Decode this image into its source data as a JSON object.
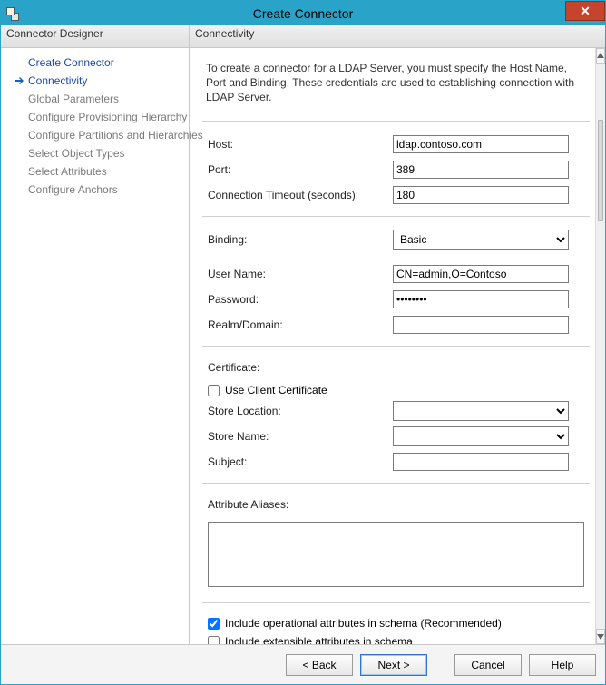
{
  "window": {
    "title": "Create Connector"
  },
  "sidebar": {
    "header": "Connector Designer",
    "items": [
      {
        "label": "Create Connector",
        "state": "completed"
      },
      {
        "label": "Connectivity",
        "state": "current"
      },
      {
        "label": "Global Parameters",
        "state": "pending"
      },
      {
        "label": "Configure Provisioning Hierarchy",
        "state": "pending"
      },
      {
        "label": "Configure Partitions and Hierarchies",
        "state": "pending"
      },
      {
        "label": "Select Object Types",
        "state": "pending"
      },
      {
        "label": "Select Attributes",
        "state": "pending"
      },
      {
        "label": "Configure Anchors",
        "state": "pending"
      }
    ]
  },
  "main": {
    "header": "Connectivity",
    "intro": "To create a connector for a LDAP Server, you must specify the Host Name, Port and Binding. These credentials are used to establishing connection with LDAP Server.",
    "host_label": "Host:",
    "host_value": "ldap.contoso.com",
    "port_label": "Port:",
    "port_value": "389",
    "timeout_label": "Connection Timeout (seconds):",
    "timeout_value": "180",
    "binding_label": "Binding:",
    "binding_value": "Basic",
    "username_label": "User Name:",
    "username_value": "CN=admin,O=Contoso",
    "password_label": "Password:",
    "password_value": "********",
    "realm_label": "Realm/Domain:",
    "realm_value": "",
    "certificate_label": "Certificate:",
    "use_client_cert_label": "Use Client Certificate",
    "use_client_cert_checked": false,
    "store_location_label": "Store Location:",
    "store_location_value": "",
    "store_name_label": "Store Name:",
    "store_name_value": "",
    "subject_label": "Subject:",
    "subject_value": "",
    "aliases_label": "Attribute Aliases:",
    "aliases_value": "",
    "include_operational_label": "Include operational attributes in schema (Recommended)",
    "include_operational_checked": true,
    "include_extensible_label": "Include extensible attributes in schema",
    "include_extensible_checked": false
  },
  "footer": {
    "back": "<  Back",
    "next": "Next  >",
    "cancel": "Cancel",
    "help": "Help"
  }
}
